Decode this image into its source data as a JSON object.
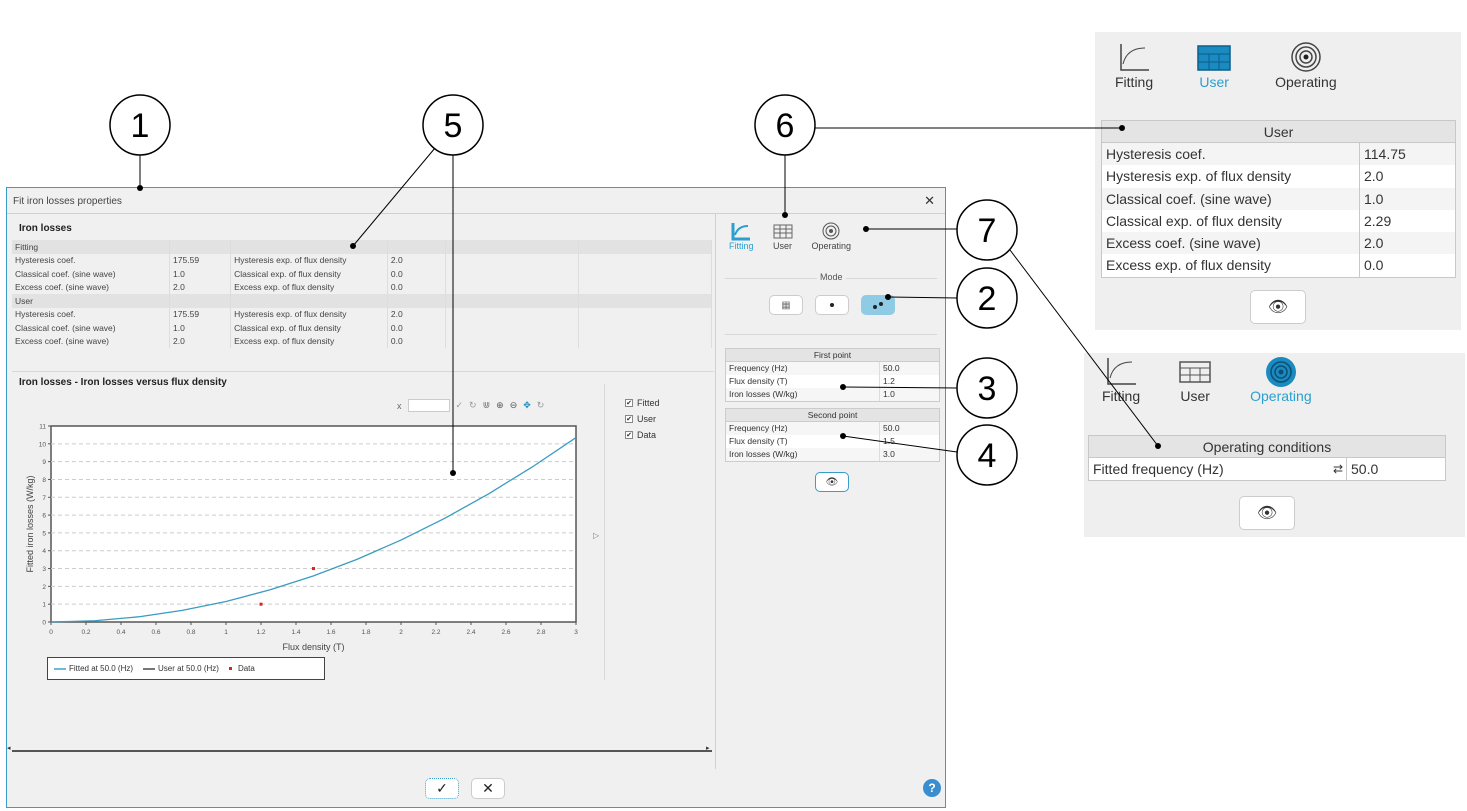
{
  "callouts": [
    "1",
    "2",
    "3",
    "4",
    "5",
    "6",
    "7"
  ],
  "dialog": {
    "title": "Fit iron losses properties",
    "close": "✕",
    "section_title": "Iron losses",
    "fitting_header": "Fitting",
    "fitting_rows": [
      [
        "Hysteresis coef.",
        "175.59",
        "Hysteresis exp. of flux density",
        "2.0"
      ],
      [
        "Classical coef. (sine wave)",
        "1.0",
        "Classical exp. of flux density",
        "0.0"
      ],
      [
        "Excess coef. (sine wave)",
        "2.0",
        "Excess exp. of flux density",
        "0.0"
      ]
    ],
    "user_header": "User",
    "user_rows": [
      [
        "Hysteresis coef.",
        "175.59",
        "Hysteresis exp. of flux density",
        "2.0"
      ],
      [
        "Classical coef. (sine wave)",
        "1.0",
        "Classical exp. of flux density",
        "0.0"
      ],
      [
        "Excess coef. (sine wave)",
        "2.0",
        "Excess exp. of flux density",
        "0.0"
      ]
    ],
    "chart_title": "Iron losses - Iron losses versus flux density",
    "x_label": "x",
    "x_value": "",
    "checkboxes": [
      "Fitted",
      "User",
      "Data"
    ]
  },
  "side": {
    "tabs": [
      "Fitting",
      "User",
      "Operating"
    ],
    "active_tab": "Fitting",
    "mode_label": "Mode",
    "first_point": {
      "title": "First point",
      "rows": [
        [
          "Frequency (Hz)",
          "50.0"
        ],
        [
          "Flux density (T)",
          "1.2"
        ],
        [
          "Iron losses (W/kg)",
          "1.0"
        ]
      ]
    },
    "second_point": {
      "title": "Second point",
      "rows": [
        [
          "Frequency (Hz)",
          "50.0"
        ],
        [
          "Flux density (T)",
          "1.5"
        ],
        [
          "Iron losses (W/kg)",
          "3.0"
        ]
      ]
    }
  },
  "panel_user": {
    "tabs": [
      "Fitting",
      "User",
      "Operating"
    ],
    "title": "User",
    "rows": [
      [
        "Hysteresis coef.",
        "114.75"
      ],
      [
        "Hysteresis exp. of flux density",
        "2.0"
      ],
      [
        "Classical coef. (sine wave)",
        "1.0"
      ],
      [
        "Classical exp. of flux density",
        "2.29"
      ],
      [
        "Excess coef. (sine wave)",
        "2.0"
      ],
      [
        "Excess exp. of flux density",
        "0.0"
      ]
    ]
  },
  "panel_operating": {
    "tabs": [
      "Fitting",
      "User",
      "Operating"
    ],
    "title": "Operating conditions",
    "row_label": "Fitted frequency (Hz)",
    "row_value": "50.0"
  },
  "colors": {
    "accent": "#2a9fd0",
    "curve": "#3a9cc0",
    "data": "#e02020",
    "user": "#4472c4"
  },
  "chart_data": {
    "type": "line",
    "title": "Iron losses - Iron losses versus flux density",
    "xlabel": "Flux density (T)",
    "ylabel": "Fitted iron losses (W/kg)",
    "xlim": [
      0,
      3
    ],
    "ylim": [
      0,
      11
    ],
    "xticks": [
      "0",
      "0.2",
      "0.4",
      "0.6",
      "0.8",
      "1",
      "1.2",
      "1.4",
      "1.6",
      "1.8",
      "2",
      "2.2",
      "2.4",
      "2.6",
      "2.8",
      "3"
    ],
    "yticks": [
      "0",
      "1",
      "2",
      "3",
      "4",
      "5",
      "6",
      "7",
      "8",
      "9",
      "10",
      "11"
    ],
    "grid": true,
    "series": [
      {
        "name": "Fitted at 50.0 (Hz)",
        "type": "line",
        "x": [
          0,
          0.25,
          0.5,
          0.75,
          1,
          1.25,
          1.5,
          1.75,
          2,
          2.25,
          2.5,
          2.75,
          3
        ],
        "y": [
          0,
          0.07,
          0.29,
          0.65,
          1.15,
          1.8,
          2.59,
          3.52,
          4.6,
          5.82,
          7.19,
          8.7,
          10.35
        ]
      },
      {
        "name": "User at 50.0 (Hz)",
        "type": "line",
        "x": [],
        "y": []
      },
      {
        "name": "Data",
        "type": "scatter",
        "x": [
          1.2,
          1.5
        ],
        "y": [
          1.0,
          3.0
        ]
      }
    ],
    "legend_position": "bottom-left"
  }
}
